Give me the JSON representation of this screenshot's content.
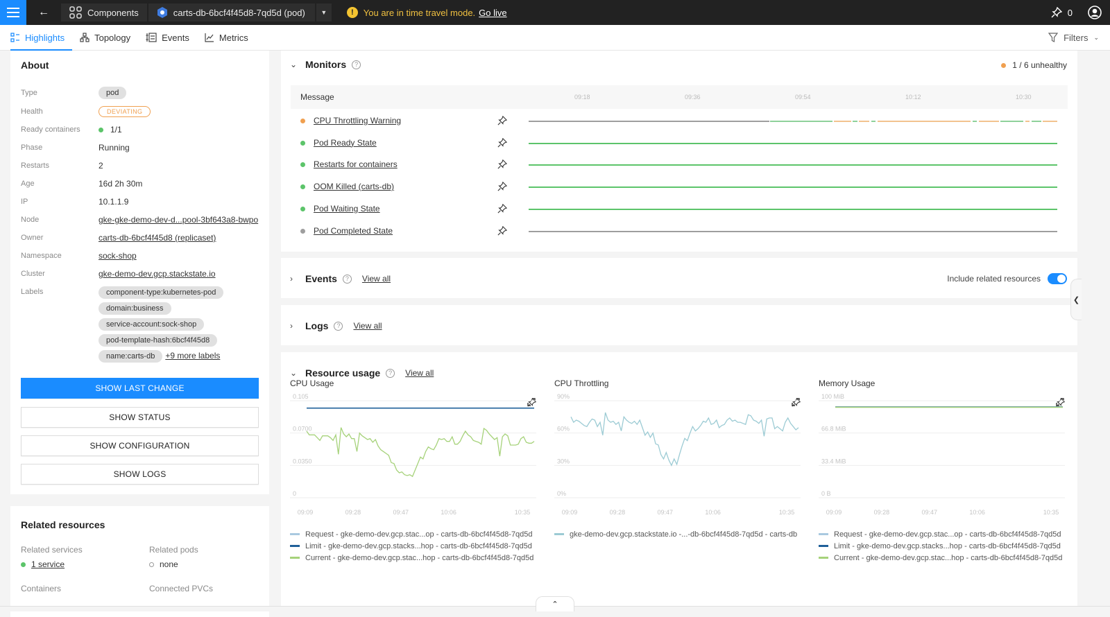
{
  "topbar": {
    "breadcrumb_components": "Components",
    "breadcrumb_component": "carts-db-6bcf4f45d8-7qd5d (pod)",
    "time_travel_message": "You are in time travel mode.",
    "go_live": "Go live",
    "pinned_count": "0"
  },
  "tabs": [
    {
      "label": "Highlights",
      "icon": "highlights-icon",
      "active": true
    },
    {
      "label": "Topology",
      "icon": "topology-icon"
    },
    {
      "label": "Events",
      "icon": "events-icon"
    },
    {
      "label": "Metrics",
      "icon": "metrics-icon"
    }
  ],
  "filters_label": "Filters",
  "about": {
    "title": "About",
    "properties": [
      {
        "key": "Type",
        "value": "pod"
      },
      {
        "key": "Health",
        "value": "DEVIATING"
      },
      {
        "key": "Ready containers",
        "value": "1/1"
      },
      {
        "key": "Phase",
        "value": "Running"
      },
      {
        "key": "Restarts",
        "value": "2"
      },
      {
        "key": "Age",
        "value": "16d 2h 30m"
      },
      {
        "key": "IP",
        "value": "10.1.1.9"
      },
      {
        "key": "Node",
        "value": "gke-gke-demo-dev-d...pool-3bf643a8-bwpo"
      },
      {
        "key": "Owner",
        "value": "carts-db-6bcf4f45d8 (replicaset)"
      },
      {
        "key": "Namespace",
        "value": "sock-shop"
      },
      {
        "key": "Cluster",
        "value": "gke-demo-dev.gcp.stackstate.io"
      },
      {
        "key": "Labels",
        "value": ""
      }
    ],
    "labels": [
      "component-type:kubernetes-pod",
      "domain:business",
      "service-account:sock-shop",
      "pod-template-hash:6bcf4f45d8",
      "name:carts-db"
    ],
    "more_labels": "+9 more labels",
    "buttons": {
      "last_change": "SHOW LAST CHANGE",
      "status": "SHOW STATUS",
      "configuration": "SHOW CONFIGURATION",
      "logs": "SHOW LOGS"
    }
  },
  "related": {
    "title": "Related resources",
    "services_label": "Related services",
    "services_value": "1 service",
    "pods_label": "Related pods",
    "pods_value": "none",
    "containers_label": "Containers",
    "pvcs_label": "Connected PVCs"
  },
  "monitors": {
    "title": "Monitors",
    "summary": "1 / 6 unhealthy",
    "column_message": "Message",
    "ticks": [
      "09:18",
      "09:36",
      "09:54",
      "10:12",
      "10:30"
    ],
    "rows": [
      {
        "name": "CPU Throttling Warning",
        "status": "deviating"
      },
      {
        "name": "Pod Ready State",
        "status": "clear"
      },
      {
        "name": "Restarts for containers",
        "status": "clear"
      },
      {
        "name": "OOM Killed (carts-db)",
        "status": "clear"
      },
      {
        "name": "Pod Waiting State",
        "status": "clear"
      },
      {
        "name": "Pod Completed State",
        "status": "unknown"
      }
    ],
    "colors": {
      "clear": "#5cc46a",
      "deviating": "#f0a050",
      "unknown": "#9e9e9e"
    }
  },
  "events": {
    "title": "Events",
    "view_all": "View all",
    "include_related": "Include related resources",
    "include_related_on": true
  },
  "logs": {
    "title": "Logs",
    "view_all": "View all"
  },
  "resource_usage": {
    "title": "Resource usage",
    "view_all": "View all"
  },
  "chart_data": [
    {
      "type": "line",
      "title": "CPU Usage",
      "yticks": [
        "0",
        "0.0350",
        "0.0700",
        "0.105"
      ],
      "ylim": [
        0,
        0.105
      ],
      "xticks": [
        "09:09",
        "09:28",
        "09:47",
        "10:06",
        "10:35"
      ],
      "series": [
        {
          "name": "Request - gke-demo-dev.gcp.stac...op - carts-db-6bcf4f45d8-7qd5d",
          "color": "#a9c9e0",
          "values": []
        },
        {
          "name": "Limit - gke-demo-dev.gcp.stacks...hop - carts-db-6bcf4f45d8-7qd5d",
          "color": "#1f5f99",
          "values": [
            0.097,
            0.097
          ]
        },
        {
          "name": "Current - gke-demo-dev.gcp.stac...hop - carts-db-6bcf4f45d8-7qd5d",
          "color": "#a6d27a",
          "values": [
            0.072,
            0.068,
            0.068,
            0.068,
            0.065,
            0.062,
            0.067,
            0.067,
            0.067,
            0.065,
            0.062,
            0.068,
            0.047,
            0.076,
            0.069,
            0.066,
            0.069,
            0.064,
            0.064,
            0.05,
            0.07,
            0.067,
            0.065,
            0.063,
            0.064,
            0.06,
            0.063,
            0.056,
            0.052,
            0.05,
            0.048,
            0.046,
            0.038,
            0.037,
            0.03,
            0.027,
            0.028,
            0.025,
            0.024,
            0.025,
            0.023,
            0.03,
            0.037,
            0.044,
            0.042,
            0.05,
            0.055,
            0.053,
            0.052,
            0.057,
            0.064,
            0.063,
            0.064,
            0.061,
            0.061,
            0.066,
            0.058,
            0.058,
            0.061,
            0.067,
            0.072,
            0.068,
            0.066,
            0.062,
            0.061,
            0.06,
            0.058,
            0.075,
            0.073,
            0.069,
            0.066,
            0.063,
            0.065,
            0.045,
            0.066,
            0.069,
            0.067,
            0.057,
            0.057,
            0.057,
            0.058,
            0.064,
            0.066,
            0.06,
            0.059,
            0.059,
            0.061
          ]
        }
      ]
    },
    {
      "type": "line",
      "title": "CPU Throttling",
      "yticks": [
        "0%",
        "30%",
        "60%",
        "90%"
      ],
      "ylim": [
        0,
        90
      ],
      "xticks": [
        "09:09",
        "09:28",
        "09:47",
        "10:06",
        "10:35"
      ],
      "series": [
        {
          "name": "gke-demo-dev.gcp.stackstate.io -...-db-6bcf4f45d8-7qd5d - carts-db",
          "color": "#9ccbd4",
          "values": [
            75,
            70,
            72,
            71,
            69,
            67,
            66,
            70,
            73,
            72,
            66,
            70,
            58,
            79,
            72,
            70,
            71,
            68,
            70,
            62,
            75,
            72,
            70,
            69,
            71,
            68,
            72,
            65,
            58,
            61,
            56,
            60,
            50,
            49,
            40,
            36,
            42,
            35,
            30,
            36,
            31,
            40,
            48,
            55,
            53,
            60,
            66,
            62,
            64,
            67,
            71,
            70,
            74,
            68,
            69,
            72,
            65,
            67,
            68,
            72,
            74,
            71,
            72,
            70,
            70,
            69,
            68,
            77,
            76,
            72,
            71,
            69,
            72,
            57,
            73,
            74,
            74,
            64,
            66,
            64,
            62,
            70,
            74,
            69,
            66,
            63,
            65
          ]
        }
      ]
    },
    {
      "type": "line",
      "title": "Memory Usage",
      "yticks": [
        "0 B",
        "33.4 MiB",
        "66.8 MiB",
        "100 MiB"
      ],
      "ylim": [
        0,
        100
      ],
      "xticks": [
        "09:09",
        "09:28",
        "09:47",
        "10:06",
        "10:35"
      ],
      "series": [
        {
          "name": "Request - gke-demo-dev.gcp.stac...op - carts-db-6bcf4f45d8-7qd5d",
          "color": "#a9c9e0",
          "values": [
            93.5,
            93.5
          ]
        },
        {
          "name": "Limit - gke-demo-dev.gcp.stacks...hop - carts-db-6bcf4f45d8-7qd5d",
          "color": "#1f5f99",
          "values": [
            93.5,
            93.5
          ]
        },
        {
          "name": "Current - gke-demo-dev.gcp.stac...hop - carts-db-6bcf4f45d8-7qd5d",
          "color": "#a6d27a",
          "values": [
            93.3,
            93.3
          ]
        }
      ]
    }
  ]
}
